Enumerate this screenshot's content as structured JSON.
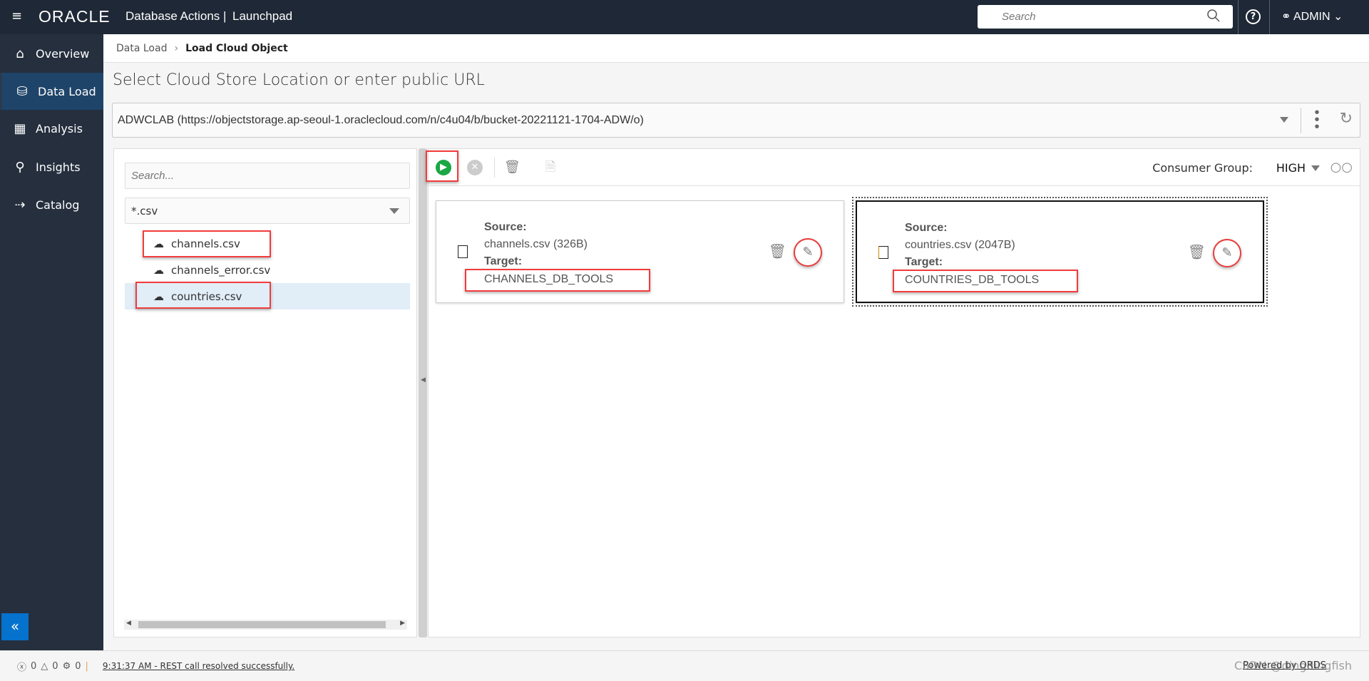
{
  "header": {
    "menu_icon": "hamburger-icon",
    "logo": "ORACLE",
    "app_name": "Database Actions |",
    "page": "Launchpad",
    "search_placeholder": "Search",
    "help_icon": "help-circle-icon",
    "user": "ADMIN"
  },
  "sidebar": {
    "items": [
      {
        "label": "Overview",
        "icon": "home-icon"
      },
      {
        "label": "Data Load",
        "icon": "database-upload-icon",
        "active": true
      },
      {
        "label": "Analysis",
        "icon": "table-search-icon"
      },
      {
        "label": "Insights",
        "icon": "person-search-icon"
      },
      {
        "label": "Catalog",
        "icon": "catalog-icon"
      }
    ],
    "collapse_icon": "double-chevron-left-icon"
  },
  "breadcrumb": {
    "parent": "Data Load",
    "current": "Load Cloud Object"
  },
  "title": "Select Cloud Store Location or enter public URL",
  "location": {
    "value": "ADWCLAB (https://objectstorage.ap-seoul-1.oraclecloud.com/n/c4u04/b/bucket-20221121-1704-ADW/o)"
  },
  "file_browser": {
    "search_placeholder": "Search...",
    "filter": "*.csv",
    "files": [
      {
        "name": "channels.csv",
        "selected": false
      },
      {
        "name": "channels_error.csv",
        "selected": false
      },
      {
        "name": "countries.csv",
        "selected": true
      }
    ]
  },
  "toolbar": {
    "consumer_group_label": "Consumer Group:",
    "consumer_group_value": "HIGH"
  },
  "cards": [
    {
      "source_label": "Source:",
      "source": "channels.csv (326B)",
      "target_label": "Target:",
      "target": "CHANNELS_DB_TOOLS"
    },
    {
      "source_label": "Source:",
      "source": "countries.csv (2047B)",
      "target_label": "Target:",
      "target": "COUNTRIES_DB_TOOLS"
    }
  ],
  "status": {
    "errors": "0",
    "warnings": "0",
    "tasks": "0",
    "message": "9:31:37 AM - REST call resolved successfully.",
    "powered_by": "Powered by ORDS",
    "watermark": "CSDN @dingdingfish"
  },
  "colors": {
    "header": "#1f2836",
    "sidebar": "#252f3e",
    "active": "#1f4469",
    "run": "#1aa745",
    "highlight": "#f23c3c"
  }
}
